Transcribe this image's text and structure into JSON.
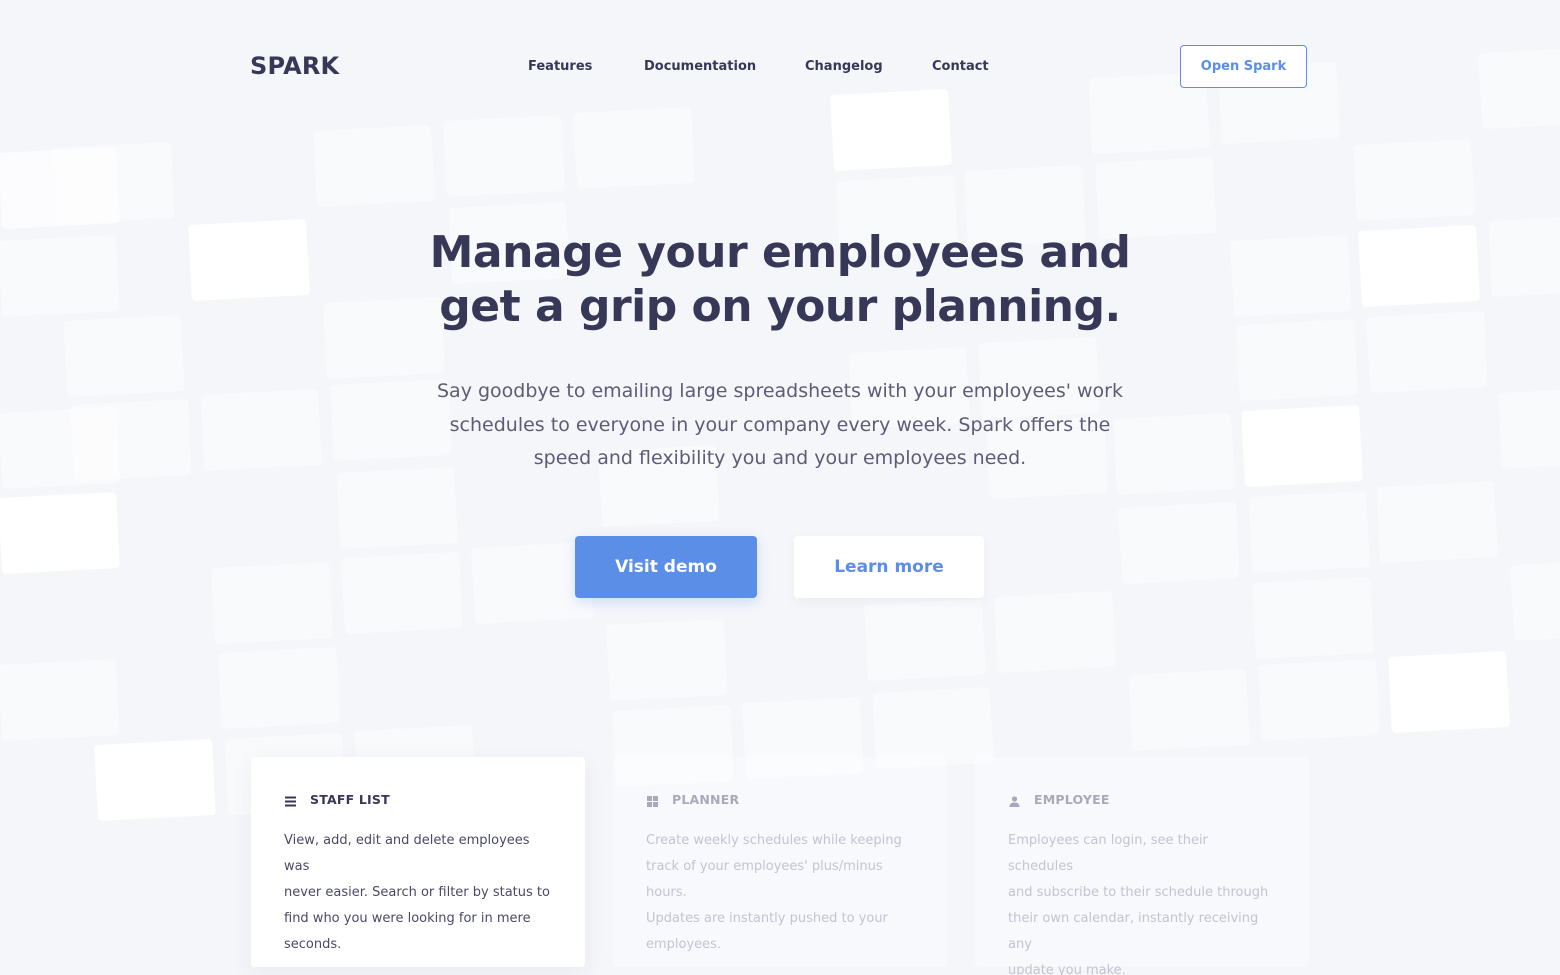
{
  "brand": {
    "logo": "SPARK",
    "accent_color": "#5b8ee6",
    "text_color": "#373757",
    "background_color": "#f5f6fa"
  },
  "nav": {
    "links": [
      "Features",
      "Documentation",
      "Changelog",
      "Contact"
    ],
    "open_button": "Open Spark"
  },
  "hero": {
    "title_line1": "Manage your employees and",
    "title_line2": "get a grip on your planning.",
    "subtitle_line1": "Say goodbye to emailing large spreadsheets with your employees' work",
    "subtitle_line2": "schedules to everyone in your company every week. Spark offers the",
    "subtitle_line3": "speed and flexibility you and your employees need.",
    "primary_button": "Visit demo",
    "secondary_button": "Learn more"
  },
  "features": [
    {
      "icon": "list-icon",
      "title": "STAFF LIST",
      "active": true,
      "lines": [
        "View, add, edit and delete employees was",
        "never easier. Search or filter by status to",
        "find who you were looking for in mere",
        "seconds."
      ]
    },
    {
      "icon": "grid-icon",
      "title": "PLANNER",
      "active": false,
      "lines": [
        "Create weekly schedules while keeping",
        "track of your employees' plus/minus hours.",
        "Updates are instantly pushed to your",
        "employees."
      ]
    },
    {
      "icon": "user-icon",
      "title": "EMPLOYEE",
      "active": false,
      "lines": [
        "Employees can login, see their schedules",
        "and subscribe to their schedule through",
        "their own calendar, instantly receiving any",
        "update you make."
      ]
    }
  ]
}
